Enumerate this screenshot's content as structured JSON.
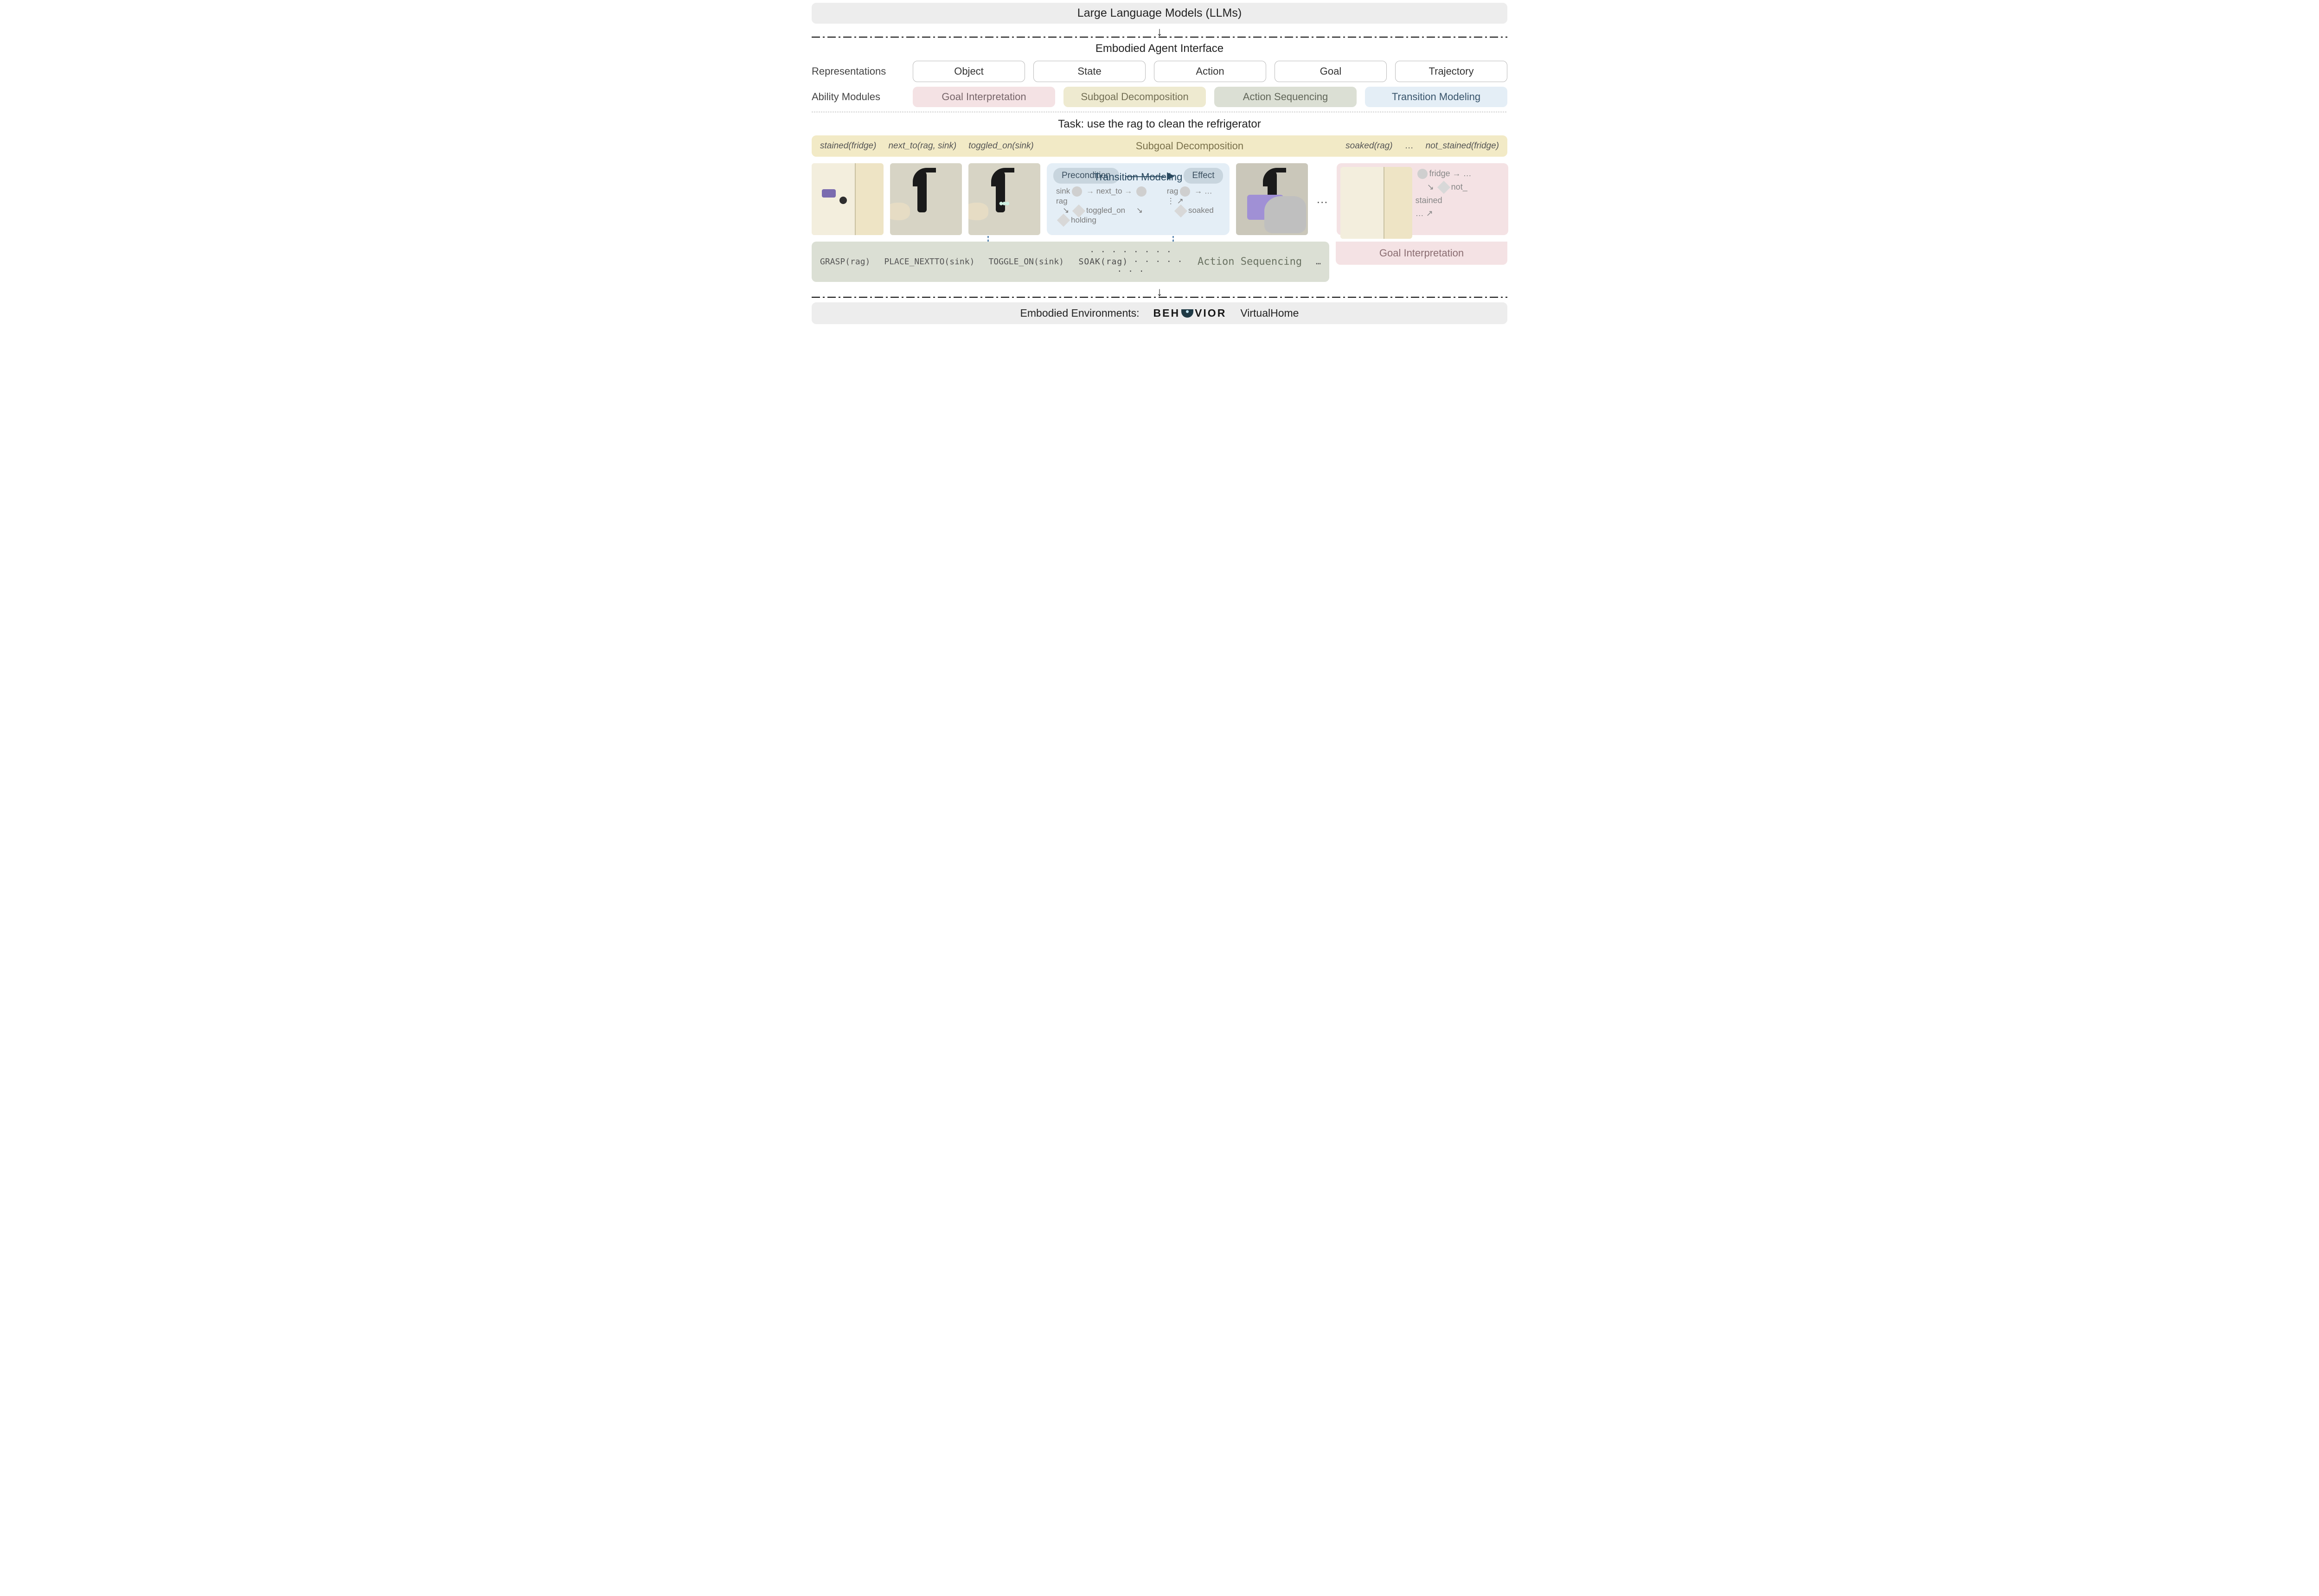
{
  "top_banner": "Large Language Models (LLMs)",
  "interface_title": "Embodied Agent Interface",
  "row_labels": {
    "representations": "Representations",
    "abilities": "Ability Modules"
  },
  "representations": [
    "Object",
    "State",
    "Action",
    "Goal",
    "Trajectory"
  ],
  "abilities": {
    "goal_interpretation": "Goal Interpretation",
    "subgoal_decomposition": "Subgoal Decomposition",
    "action_sequencing": "Action Sequencing",
    "transition_modeling": "Transition Modeling"
  },
  "task_title": "Task: use the rag to clean the refrigerator",
  "subgoal_bar": {
    "left": [
      "stained(fridge)",
      "next_to(rag, sink)",
      "toggled_on(sink)"
    ],
    "label": "Subgoal Decomposition",
    "right": [
      "soaked(rag)",
      "…",
      "not_stained(fridge)"
    ]
  },
  "transition_panel": {
    "precondition": "Precondition",
    "title": "Transition Modeling",
    "effect": "Effect",
    "left_graph": {
      "n1": "sink",
      "e1": "next_to",
      "n2": "rag",
      "p1": "toggled_on",
      "p2": "holding"
    },
    "right_graph": {
      "n1": "rag",
      "dots": "⋮",
      "p1": "soaked"
    }
  },
  "goal_panel": {
    "node": "fridge",
    "dots": "…",
    "predicate": "not_\nstained",
    "label": "Goal Interpretation"
  },
  "action_bar": {
    "actions": [
      "GRASP(rag)",
      "PLACE_NEXTTO(sink)",
      "TOGGLE_ON(sink)"
    ],
    "center": "SOAK(rag)",
    "label": "Action Sequencing",
    "dots": "…"
  },
  "bottom_banner": {
    "prefix": "Embodied Environments:",
    "behavior": "BEH  VIOR",
    "virtualhome": "VirtualHome"
  }
}
